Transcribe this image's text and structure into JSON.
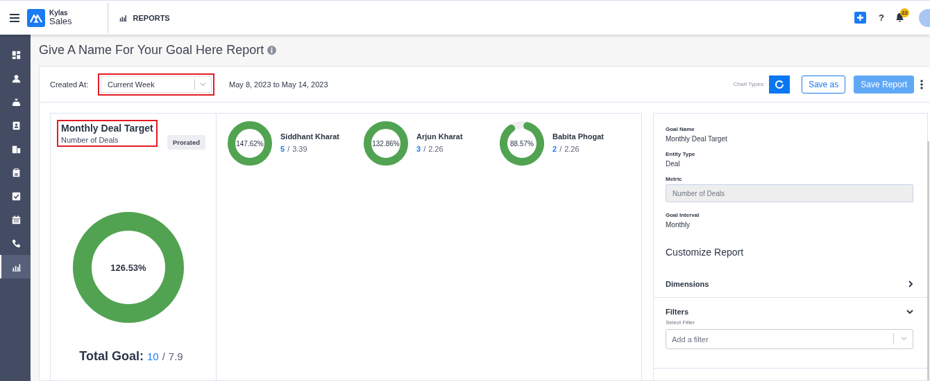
{
  "topbar": {
    "brand_top": "Kylas",
    "brand_bottom": "Sales",
    "section": "REPORTS",
    "help": "?",
    "notification_count": "22"
  },
  "sidebar": {
    "items": [
      {
        "kind": "dashboard",
        "selected": false
      },
      {
        "kind": "person",
        "selected": false
      },
      {
        "kind": "money",
        "selected": false
      },
      {
        "kind": "contact",
        "selected": false
      },
      {
        "kind": "building",
        "selected": false
      },
      {
        "kind": "clipboard",
        "selected": false
      },
      {
        "kind": "task",
        "selected": false
      },
      {
        "kind": "calendar",
        "selected": false
      },
      {
        "kind": "phone",
        "selected": false
      },
      {
        "kind": "report",
        "selected": true
      }
    ]
  },
  "page_title": "Give A Name For Your Goal Here Report",
  "toolbar": {
    "filter_label": "Created At:",
    "filter": {
      "value": "Current Week",
      "highlighted": true
    },
    "date_range": "May 8, 2023 to May 14, 2023",
    "chart_types_label": "Chart Types:",
    "buttons": [
      {
        "label": "Save as",
        "kind": "outline"
      },
      {
        "label": "Save Report",
        "kind": "primary"
      }
    ]
  },
  "goal": {
    "title": "Monthly Deal Target",
    "subtitle": "Number of Deals",
    "highlighted": true,
    "badge": "Prorated",
    "percent": "126.53%",
    "level": 1,
    "total_label": "Total Goal:",
    "achieved": "10",
    "separator": "/",
    "target": "7.9"
  },
  "users": [
    {
      "name": "Siddhant Kharat",
      "percent": "147.62%",
      "level": 1,
      "achieved": "5",
      "separator": "/",
      "target": "3.39"
    },
    {
      "name": "Arjun Kharat",
      "percent": "132.86%",
      "level": 1,
      "achieved": "3",
      "separator": "/",
      "target": "2.26"
    },
    {
      "name": "Babita Phogat",
      "percent": "88.57%",
      "level": 0.8857,
      "achieved": "2",
      "separator": "/",
      "target": "2.26"
    }
  ],
  "details": {
    "fields": [
      {
        "label": "Goal Name",
        "value": "Monthly Deal Target",
        "kind": "text"
      },
      {
        "label": "Entity Type",
        "value": "Deal",
        "kind": "text"
      },
      {
        "label": "Metric",
        "value": "Number of Deals",
        "kind": "input"
      },
      {
        "label": "Goal Interval",
        "value": "Monthly",
        "kind": "text"
      }
    ],
    "heading": "Customize Report",
    "sections": [
      {
        "title": "Dimensions",
        "expanded": false
      },
      {
        "title": "Filters",
        "expanded": true,
        "field_label": "Select Filter",
        "placeholder": "Add a filter"
      }
    ]
  }
}
